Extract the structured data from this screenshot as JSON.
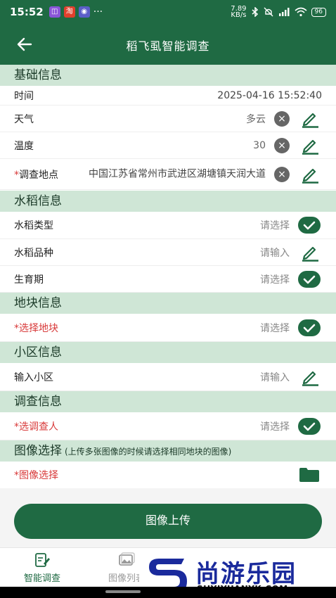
{
  "status_bar": {
    "time": "15:52",
    "apps": [
      {
        "icon": "app-icon-1",
        "glyph": "◫",
        "color": "#8a55d8"
      },
      {
        "icon": "taobao-icon",
        "glyph": "淘",
        "color": "#e2402d"
      },
      {
        "icon": "app-icon-3",
        "glyph": "◉",
        "color": "#5b5ec8"
      }
    ],
    "more": "···",
    "speed": "7.89",
    "speed_unit": "KB/s",
    "battery": "96"
  },
  "header": {
    "title": "稻飞虱智能调查",
    "back_icon": "arrow-left-icon"
  },
  "sections": {
    "basic": "基础信息",
    "rice": "水稻信息",
    "plot": "地块信息",
    "community": "小区信息",
    "survey": "调查信息",
    "image": "图像选择",
    "image_note": "(上传多张图像的时候请选择相同地块的图像)"
  },
  "fields": {
    "time": {
      "label": "时间",
      "value": "2025-04-16 15:52:40"
    },
    "weather": {
      "label": "天气",
      "value": "多云"
    },
    "temperature": {
      "label": "温度",
      "value": "30"
    },
    "location": {
      "required_mark": "*",
      "label": "调查地点",
      "value": "中国江苏省常州市武进区湖塘镇天润大道"
    },
    "rice_type": {
      "label": "水稻类型",
      "placeholder": "请选择"
    },
    "rice_variety": {
      "label": "水稻品种",
      "placeholder": "请输入"
    },
    "growth_stage": {
      "label": "生育期",
      "placeholder": "请选择"
    },
    "plot_select": {
      "required_mark": "*",
      "label": "选择地块",
      "placeholder": "请选择"
    },
    "community_input": {
      "label": "输入小区",
      "placeholder": "请输入"
    },
    "surveyor": {
      "required_mark": "*",
      "label": "选调查人",
      "placeholder": "请选择"
    },
    "image_select": {
      "required_mark": "*",
      "label": "图像选择"
    }
  },
  "upload_button": "图像上传",
  "tabs": [
    {
      "label": "智能调查",
      "icon": "survey-edit-icon",
      "active": true
    },
    {
      "label": "图像列表",
      "icon": "image-list-icon",
      "active": false
    }
  ],
  "watermark": {
    "text": "尚游乐园",
    "url": "SHYIYUANYK.COM"
  },
  "colors": {
    "primary": "#1f6a43",
    "section_bg": "#cfe6d6",
    "required": "#d83a3a"
  }
}
